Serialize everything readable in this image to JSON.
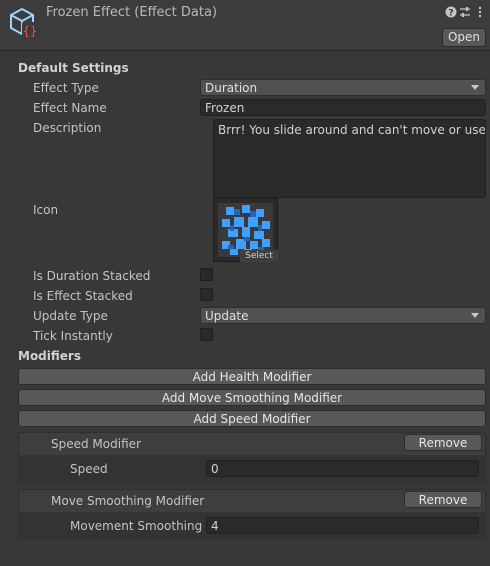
{
  "header": {
    "title": "Frozen Effect (Effect Data)",
    "open_label": "Open",
    "icons": [
      "scriptable-object-icon",
      "help-icon",
      "settings-sliders-icon",
      "more-vertical-icon"
    ]
  },
  "default_settings": {
    "label": "Default Settings",
    "effect_type": {
      "label": "Effect Type",
      "value": "Duration"
    },
    "effect_name": {
      "label": "Effect Name",
      "value": "Frozen"
    },
    "description": {
      "label": "Description",
      "value": "Brrr! You slide around and can't move or use iten"
    },
    "icon": {
      "label": "Icon",
      "select_label": "Select"
    },
    "is_duration_stacked": {
      "label": "Is Duration Stacked",
      "checked": false
    },
    "is_effect_stacked": {
      "label": "Is Effect Stacked",
      "checked": false
    },
    "update_type": {
      "label": "Update Type",
      "value": "Update"
    },
    "tick_instantly": {
      "label": "Tick Instantly",
      "checked": false
    }
  },
  "modifiers": {
    "label": "Modifiers",
    "add_health": "Add Health Modifier",
    "add_move_smoothing": "Add Move Smoothing Modifier",
    "add_speed": "Add Speed Modifier",
    "items": [
      {
        "title": "Speed Modifier",
        "remove_label": "Remove",
        "field_label": "Speed",
        "field_value": "0"
      },
      {
        "title": "Move Smoothing Modifier",
        "remove_label": "Remove",
        "field_label": "Movement Smoothing",
        "field_value": "4"
      }
    ]
  },
  "colors": {
    "background": "#383838",
    "field": "#2a2a2a",
    "button": "#585858",
    "icon_accent": "#3fa0ff",
    "script_badge": "#e05a3a"
  }
}
